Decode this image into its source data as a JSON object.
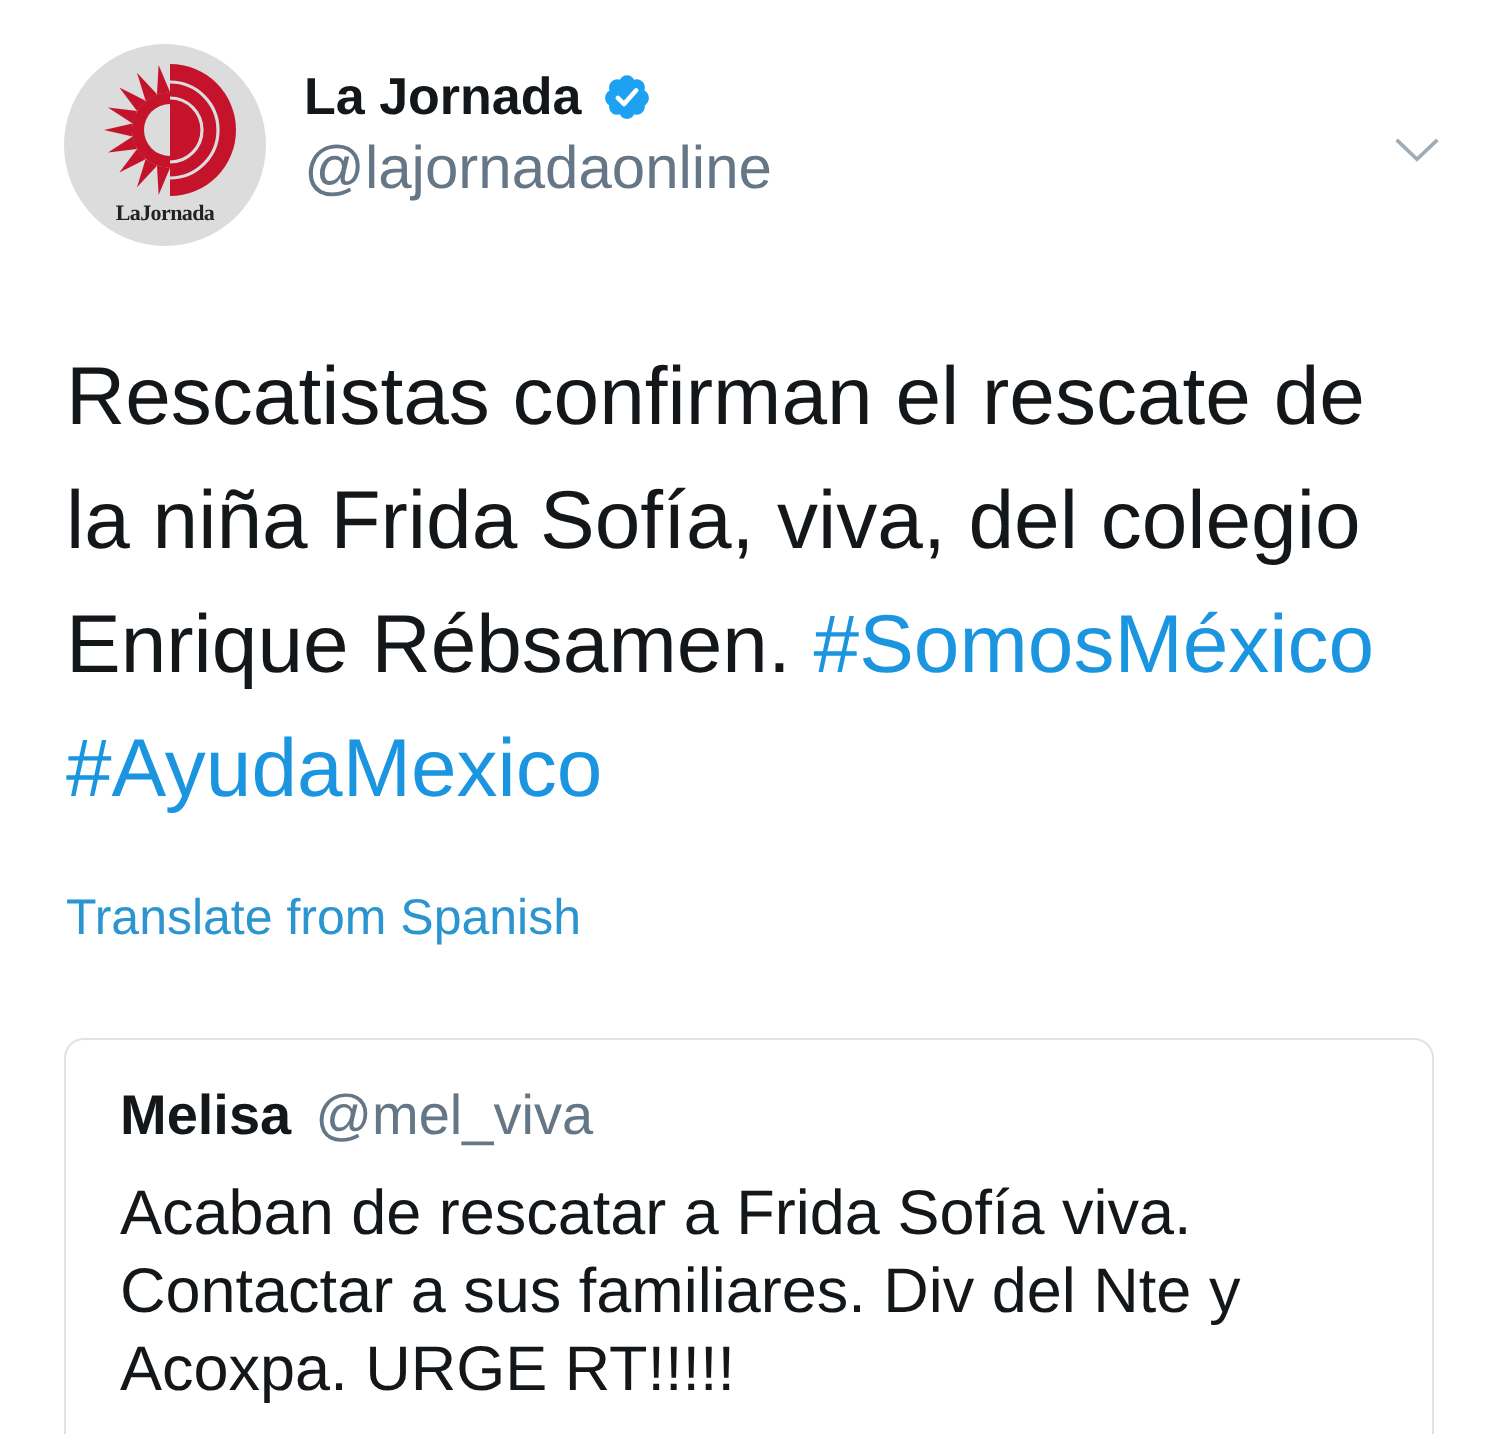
{
  "tweet": {
    "author": {
      "name": "La Jornada",
      "verified": true,
      "handle": "@lajornadaonline",
      "logo_text": "LaJornada"
    },
    "text": [
      {
        "kind": "text",
        "text": "Rescatistas confirman el rescate de la niña Frida Sofía, viva, del colegio Enrique Rébsamen."
      },
      {
        "kind": "hashtag",
        "text": "#SomosMéxico"
      },
      {
        "kind": "hashtag",
        "text": "#AyudaMexico"
      }
    ],
    "translate_link": "Translate from Spanish",
    "quoted_tweet": {
      "name": "Melisa",
      "handle": "@mel_viva",
      "text": "Acaban de rescatar a Frida Sofía viva. Contactar a sus familiares. Div del Nte y Acoxpa. URGE RT!!!!!"
    }
  }
}
